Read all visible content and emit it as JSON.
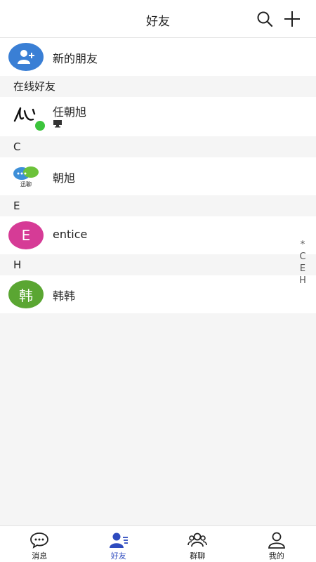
{
  "header": {
    "title": "好友"
  },
  "new_friends": {
    "label": "新的朋友"
  },
  "sections": {
    "online": "在线好友",
    "c": "C",
    "e": "E",
    "h": "H"
  },
  "contacts": {
    "online_1": {
      "name": "任朝旭"
    },
    "c_1": {
      "name": "朝旭",
      "avatar_text": "迅聊"
    },
    "e_1": {
      "name": "entice",
      "avatar_letter": "E"
    },
    "h_1": {
      "name": "韩韩",
      "avatar_letter": "韩"
    }
  },
  "index_bar": [
    "*",
    "C",
    "E",
    "H"
  ],
  "tabs": [
    {
      "label": "消息",
      "icon": "chat-icon"
    },
    {
      "label": "好友",
      "icon": "friends-icon"
    },
    {
      "label": "群聊",
      "icon": "group-icon"
    },
    {
      "label": "我的",
      "icon": "profile-icon"
    }
  ],
  "colors": {
    "accent": "#2e4bbf",
    "new_friend_avatar": "#3a7fd5",
    "e_avatar": "#d63b96",
    "h_avatar": "#5aa632",
    "online_dot": "#3cc43c"
  }
}
